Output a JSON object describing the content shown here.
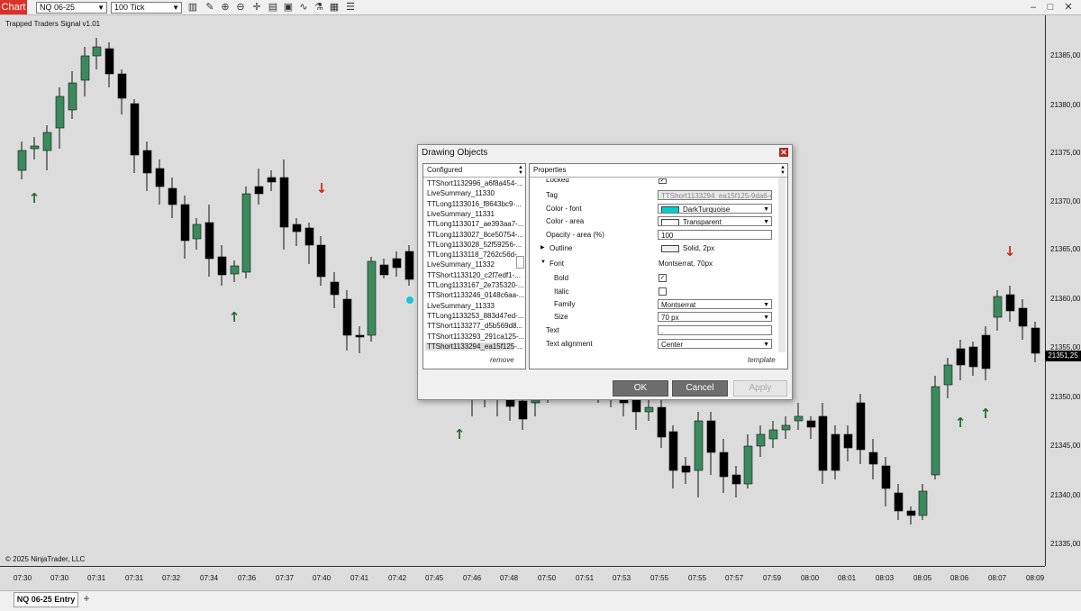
{
  "toolbar": {
    "tab_label": "Chart",
    "instrument": "NQ 06-25",
    "interval": "100 Tick",
    "icons": [
      "bar-type-icon",
      "draw-pencil-icon",
      "zoom-in-icon",
      "zoom-out-icon",
      "crosshair-icon",
      "chart-properties-icon",
      "data-box-icon",
      "indicators-icon",
      "strategies-icon",
      "more-menu-icon"
    ]
  },
  "chart": {
    "indicator_label": "Trapped Traders Signal v1.01",
    "copyright": "© 2025 NinjaTrader, LLC",
    "up_color": "#3a8a5c",
    "down_color": "#000000",
    "arrow_up_color": "#1e6e2a",
    "arrow_down_color": "#cc2a1a",
    "marker_color": "#19c6d4"
  },
  "price_axis": {
    "ticks": [
      "21385,00",
      "21380,00",
      "21375,00",
      "21370,00",
      "21365,00",
      "21360,00",
      "21355,00",
      "21350,00",
      "21345,00",
      "21340,00",
      "21335,00"
    ],
    "current_price": "21351,25"
  },
  "time_axis": {
    "ticks": [
      "07:30",
      "07:30",
      "07:31",
      "07:31",
      "07:32",
      "07:34",
      "07:36",
      "07:37",
      "07:40",
      "07:41",
      "07:42",
      "07:45",
      "07:46",
      "07:48",
      "07:50",
      "07:51",
      "07:53",
      "07:55",
      "07:55",
      "07:57",
      "07:59",
      "08:00",
      "08:01",
      "08:03",
      "08:05",
      "08:06",
      "08:07",
      "08:09"
    ]
  },
  "bottom": {
    "tab_label": "NQ 06-25 Entry",
    "add_label": "+"
  },
  "dialog": {
    "title": "Drawing Objects",
    "configured_header": "Configured",
    "properties_header": "Properties",
    "configured_items": [
      "TTShort1132996_a6f8a454-...",
      "LiveSummary_11330",
      "TTLong1133016_f8643bc9-...",
      "LiveSummary_11331",
      "TTLong1133017_ae393aa7-...",
      "TTLong1133027_8ce50754-...",
      "TTLong1133028_52f59256-...",
      "TTLong1133118_7262c56d-...",
      "LiveSummary_11332",
      "TTShort1133120_c2f7edf1-...",
      "TTLong1133167_2e735320-...",
      "TTShort1133246_0148c6aa-...",
      "LiveSummary_11333",
      "TTLong1133253_883d47ed-...",
      "TTShort1133277_d5b569d8...",
      "TTShort1133293_291ca125-...",
      "TTShort1133294_ea15f125-..."
    ],
    "remove_label": "remove",
    "template_label": "template",
    "properties": {
      "locked_label": "Locked",
      "tag_label": "Tag",
      "tag_value": "TTShort1133294_ea15f125-9da6-4d64",
      "color_font_label": "Color - font",
      "color_font_value": "DarkTurquoise",
      "color_area_label": "Color - area",
      "color_area_value": "Transparent",
      "opacity_label": "Opacity - area (%)",
      "opacity_value": "100",
      "outline_label": "Outline",
      "outline_value": "Solid, 2px",
      "font_label": "Font",
      "font_value": "Montserrat, 70px",
      "bold_label": "Bold",
      "italic_label": "Italic",
      "family_label": "Family",
      "family_value": "Montserrat",
      "size_label": "Size",
      "size_value": "70 px",
      "text_label": "Text",
      "text_value": ".",
      "text_alignment_label": "Text alignment",
      "text_alignment_value": "Center"
    },
    "ok_label": "OK",
    "cancel_label": "Cancel",
    "apply_label": "Apply"
  }
}
